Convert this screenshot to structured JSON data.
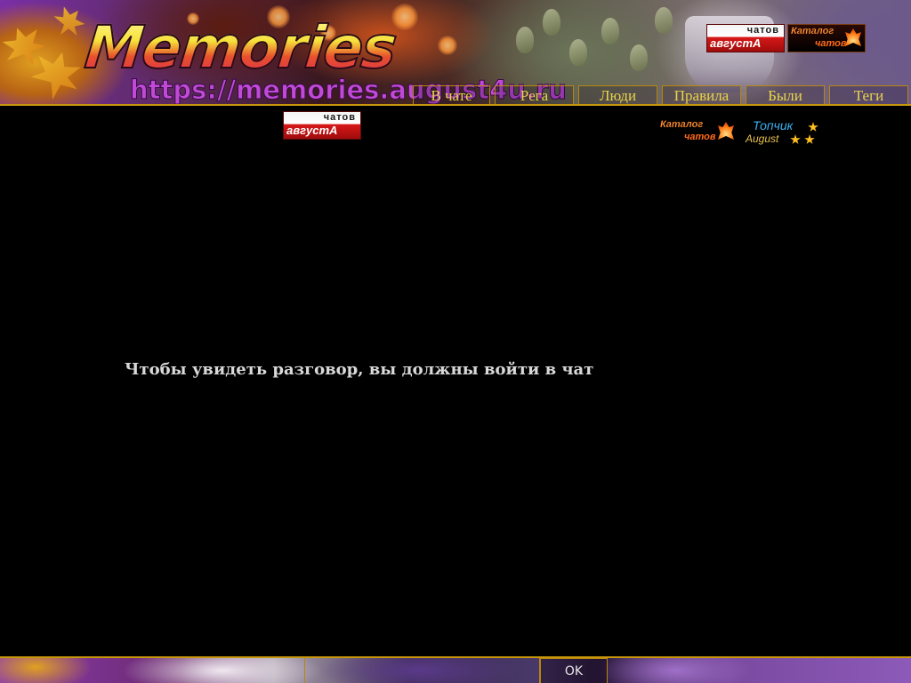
{
  "header": {
    "logo_text": "Memories",
    "url_text": "https://memories.august4u.ru"
  },
  "badges": {
    "chatov_top": "чатов",
    "chatov_bottom": "августА",
    "katalog_line1": "Каталог",
    "katalog_line2": "чатов",
    "topchik_line1": "Топчик",
    "topchik_line2": "August"
  },
  "nav": {
    "items": [
      {
        "label": "В чате"
      },
      {
        "label": "Рега"
      },
      {
        "label": "Люди"
      },
      {
        "label": "Правила"
      },
      {
        "label": "Были"
      },
      {
        "label": "Теги"
      }
    ]
  },
  "main": {
    "message": "Чтобы увидеть разговор, вы должны войти в чат"
  },
  "footer": {
    "ok_label": "OK"
  },
  "colors": {
    "background": "#000000",
    "nav_text": "#ead44a",
    "border_gold": "#c8960a",
    "message_text": "#d9d9d9"
  }
}
